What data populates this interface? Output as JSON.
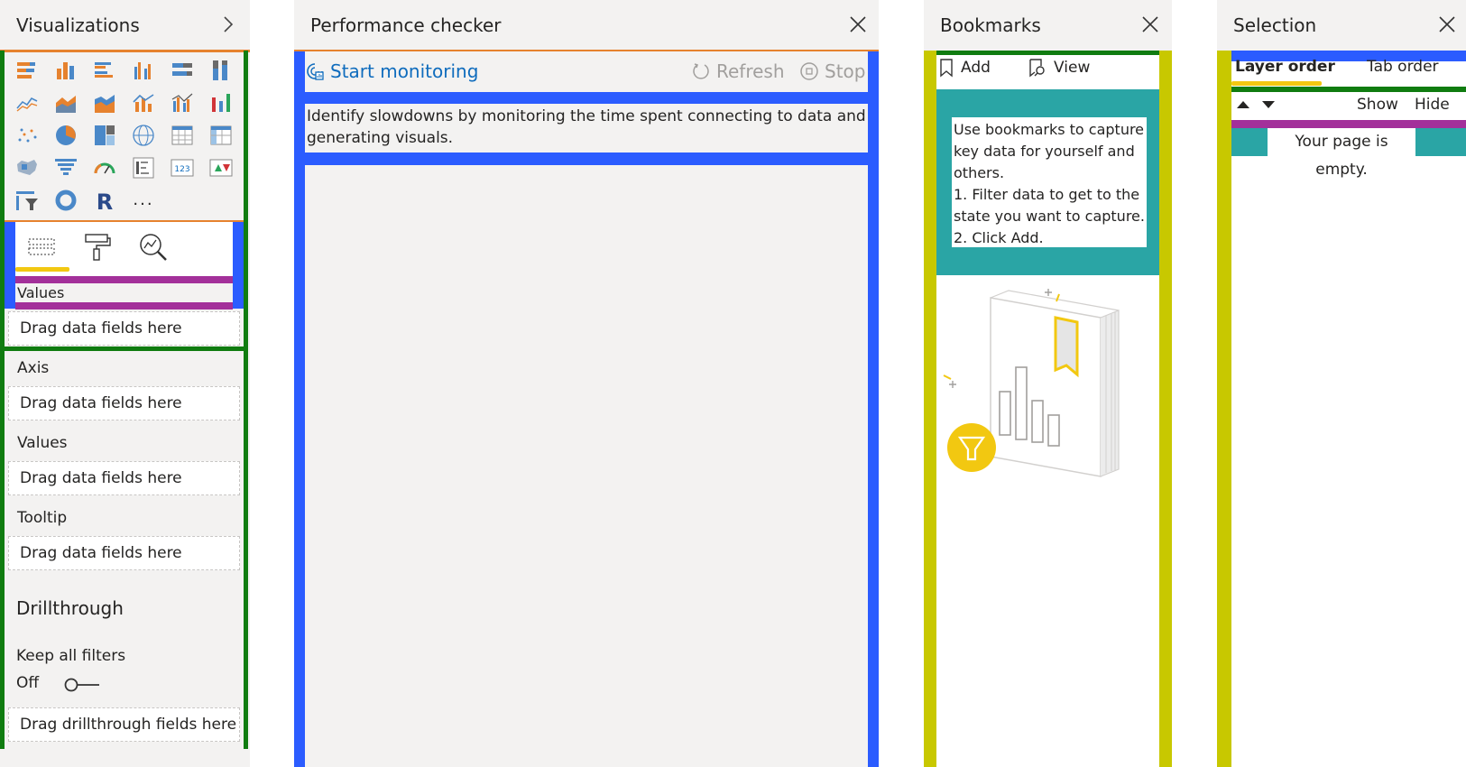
{
  "visualizations": {
    "title": "Visualizations",
    "tabs": [
      "fields-tab",
      "format-tab",
      "analytics-tab"
    ],
    "values_header": "Values",
    "values_well": "Drag data fields here",
    "axis_label": "Axis",
    "axis_well": "Drag data fields here",
    "values2_label": "Values",
    "values2_well": "Drag data fields here",
    "tooltip_label": "Tooltip",
    "tooltip_well": "Drag data fields here",
    "drillthrough_title": "Drillthrough",
    "keep_filters_label": "Keep all filters",
    "toggle_state": "Off",
    "drillthrough_well": "Drag drillthrough fields here",
    "more_label": "..."
  },
  "performance": {
    "title": "Performance checker",
    "start_label": "Start monitoring",
    "refresh_label": "Refresh",
    "stop_label": "Stop",
    "description": "Identify slowdowns by monitoring the time spent connecting to data and generating visuals."
  },
  "bookmarks": {
    "title": "Bookmarks",
    "add_label": "Add",
    "view_label": "View",
    "help_text": "Use bookmarks to capture key data for yourself and others.\n1. Filter data to get to the state you want to capture.\n2. Click Add."
  },
  "selection": {
    "title": "Selection",
    "tab_layer": "Layer order",
    "tab_tab": "Tab order",
    "show_label": "Show",
    "hide_label": "Hide",
    "empty_text": "Your page is empty."
  },
  "colors": {
    "blue": "#2b5cff",
    "green": "#107c10",
    "orange": "#e6822e",
    "yellow_green": "#c8c800",
    "purple": "#a3309a",
    "teal": "#2aa5a5",
    "link": "#0f6cbd",
    "accent_yellow": "#f2c811"
  }
}
